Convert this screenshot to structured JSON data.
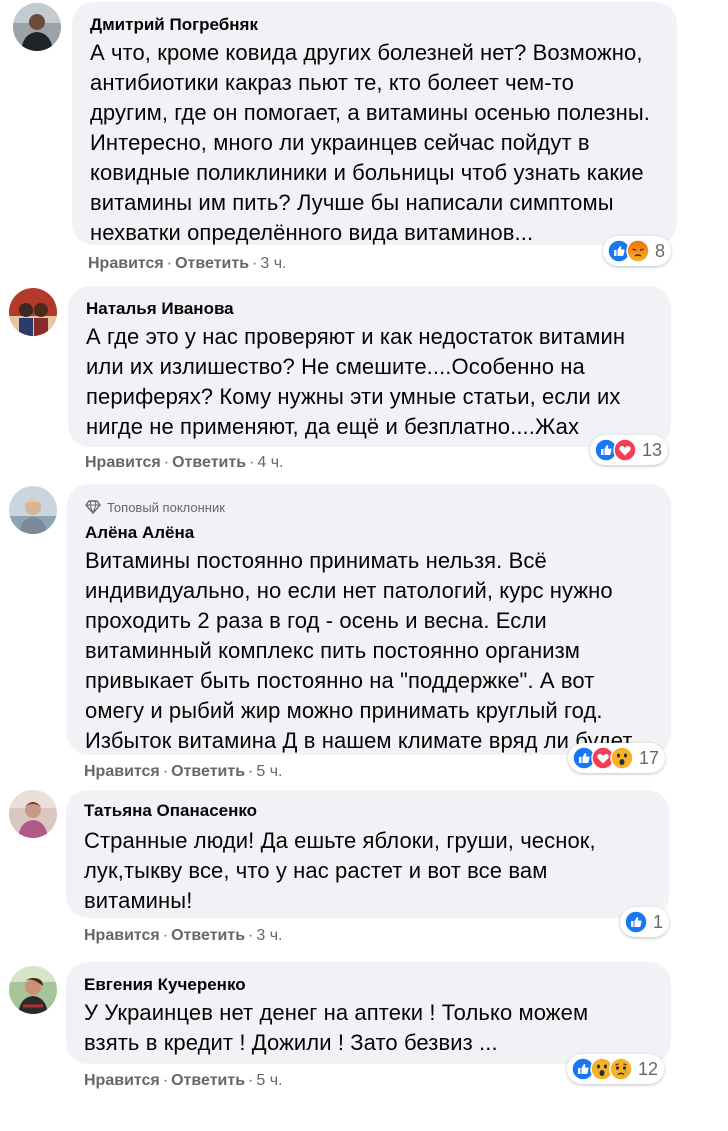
{
  "comments": [
    {
      "name": "Дмитрий Погребняк",
      "badge": "",
      "lines": [
        "А что, кроме ковида других болезней нет? Возможно,",
        "антибиотики какраз пьют те, кто болеет чем-то",
        "другим, где он помогает, а витамины осенью полезны.",
        "Интересно, много ли украинцев сейчас пойдут в",
        "ковидные поликлиники и больницы чтоб узнать какие",
        "витамины им пить? Лучше бы написали симптомы",
        "нехватки определённого вида витаминов..."
      ],
      "like_label": "Нравится",
      "reply_label": "Ответить",
      "time": "3 ч.",
      "reaction_icons": [
        "like-icon",
        "angry-icon"
      ],
      "reaction_count": "8"
    },
    {
      "name": "Наталья Иванова",
      "badge": "",
      "lines": [
        "А где это у нас проверяют и как недостаток витамин",
        "или их излишество? Не смешите....Особенно на",
        "периферях? Кому нужны эти умные статьи, если их",
        "нигде не применяют, да ещё и безплатно....Жах"
      ],
      "like_label": "Нравится",
      "reply_label": "Ответить",
      "time": "4 ч.",
      "reaction_icons": [
        "like-icon",
        "love-icon"
      ],
      "reaction_count": "13"
    },
    {
      "name": "Алёна Алёна",
      "badge": "Топовый поклонник",
      "lines": [
        "Витамины постоянно принимать нельзя. Всё",
        "индивидуально, но если нет патологий, курс нужно",
        "проходить 2 раза в год - осень и весна. Если",
        "витаминный комплекс пить постоянно организм",
        "привыкает быть постоянно на \"поддержке\". А вот",
        "омегу и рыбий жир можно принимать круглый год.",
        "Избыток витамина Д в нашем климате вряд ли будет."
      ],
      "like_label": "Нравится",
      "reply_label": "Ответить",
      "time": "5 ч.",
      "reaction_icons": [
        "like-icon",
        "love-icon",
        "wow-icon"
      ],
      "reaction_count": "17"
    },
    {
      "name": "Татьяна Опанасенко",
      "badge": "",
      "lines": [
        "Странные люди! Да ешьте яблоки, груши, чеснок,",
        "лук,тыкву все, что у нас растет и вот все вам",
        "витамины!"
      ],
      "like_label": "Нравится",
      "reply_label": "Ответить",
      "time": "3 ч.",
      "reaction_icons": [
        "like-icon"
      ],
      "reaction_count": "1"
    },
    {
      "name": "Евгения Кучеренко",
      "badge": "",
      "lines": [
        "У Украинцев нет денег на аптеки ! Только можем",
        "взять в кредит ! Дожили ! Зато безвиз ..."
      ],
      "like_label": "Нравится",
      "reply_label": "Ответить",
      "time": "5 ч.",
      "reaction_icons": [
        "like-icon",
        "wow-icon",
        "sad-icon"
      ],
      "reaction_count": "12"
    }
  ],
  "colors": {
    "bubble": "#f0f2f5",
    "secondary_text": "#65676b",
    "like_blue": "#1877f2",
    "love_red": "#f33e58",
    "emoji_yellow": "#f7b125",
    "angry_orange": "#e9710f"
  }
}
